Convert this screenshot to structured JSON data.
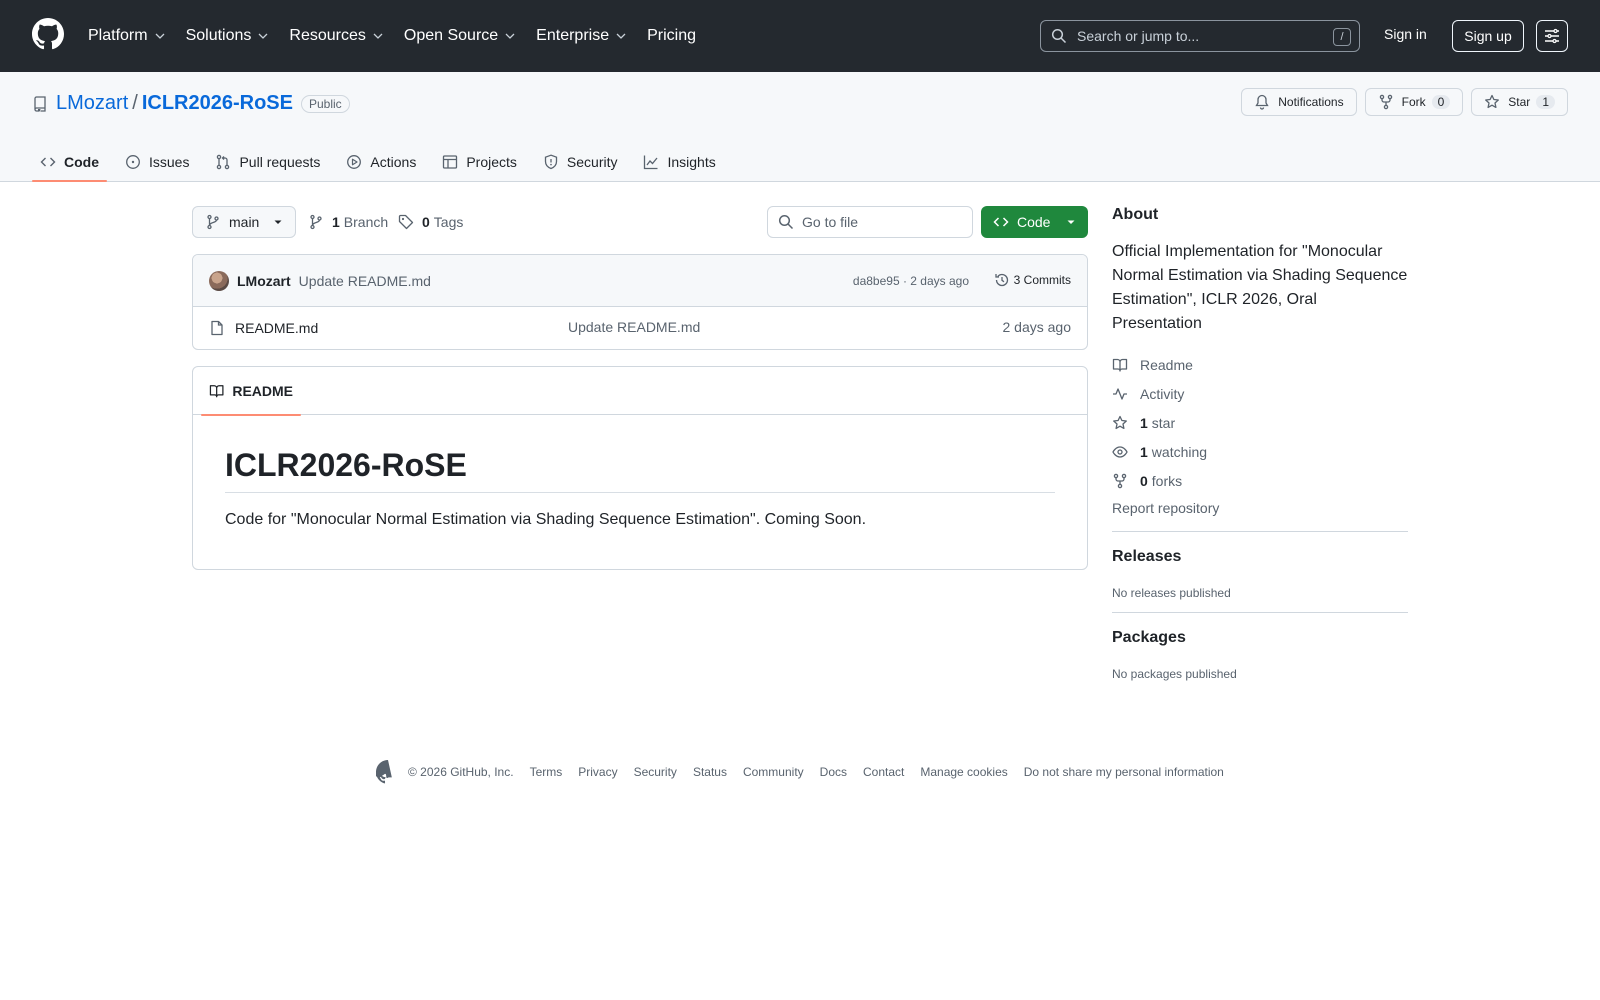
{
  "header": {
    "nav": [
      "Platform",
      "Solutions",
      "Resources",
      "Open Source",
      "Enterprise",
      "Pricing"
    ],
    "search_placeholder": "Search or jump to...",
    "search_shortcut": "/",
    "sign_in": "Sign in",
    "sign_up": "Sign up"
  },
  "repo": {
    "owner": "LMozart",
    "separator": "/",
    "name": "ICLR2026-RoSE",
    "visibility": "Public",
    "actions": {
      "notifications": "Notifications",
      "fork_label": "Fork",
      "fork_count": "0",
      "star_label": "Star",
      "star_count": "1"
    },
    "tabs": [
      "Code",
      "Issues",
      "Pull requests",
      "Actions",
      "Projects",
      "Security",
      "Insights"
    ]
  },
  "toolbar": {
    "branch": "main",
    "branch_count": "1",
    "branch_label": "Branch",
    "tag_count": "0",
    "tag_label": "Tags",
    "goto_placeholder": "Go to file",
    "code_button": "Code"
  },
  "commit": {
    "author": "LMozart",
    "message": "Update README.md",
    "meta": "da8be95 · 2 days ago",
    "count": "3 Commits"
  },
  "files": [
    {
      "name": "README.md",
      "message": "Update README.md",
      "age": "2 days ago"
    }
  ],
  "readme": {
    "tab": "README",
    "title": "ICLR2026-RoSE",
    "body": "Code for \"Monocular Normal Estimation via Shading Sequence Estimation\". Coming Soon."
  },
  "sidebar": {
    "about_title": "About",
    "description": "Official Implementation for \"Monocular Normal Estimation via Shading Sequence Estimation\", ICLR 2026, Oral Presentation",
    "readme": "Readme",
    "activity": "Activity",
    "stars_count": "1",
    "stars_label": "star",
    "watching_count": "1",
    "watching_label": "watching",
    "forks_count": "0",
    "forks_label": "forks",
    "report": "Report repository",
    "releases_title": "Releases",
    "releases_text": "No releases published",
    "packages_title": "Packages",
    "packages_text": "No packages published"
  },
  "footer": {
    "copyright": "© 2026 GitHub, Inc.",
    "links": [
      "Terms",
      "Privacy",
      "Security",
      "Status",
      "Community",
      "Docs",
      "Contact",
      "Manage cookies",
      "Do not share my personal information"
    ]
  },
  "colors": {
    "header_bg": "#24292f",
    "link": "#0969da",
    "code_button": "#1f883d",
    "tab_underline": "#fd8c73"
  }
}
